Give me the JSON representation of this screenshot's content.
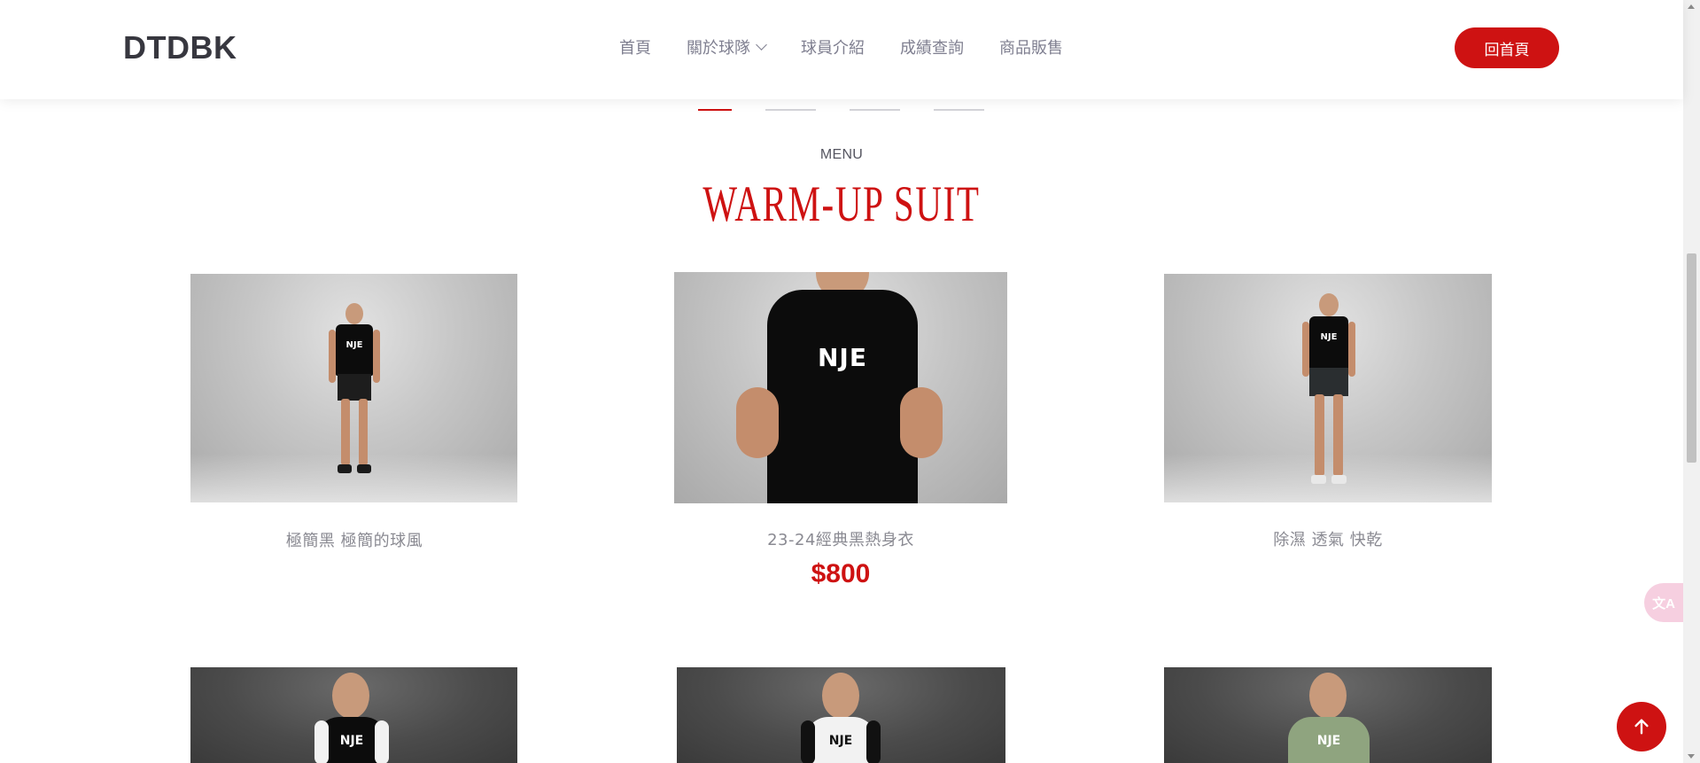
{
  "header": {
    "logo": "DTDBK",
    "nav": [
      {
        "label": "首頁"
      },
      {
        "label": "關於球隊",
        "has_dropdown": true
      },
      {
        "label": "球員介紹"
      },
      {
        "label": "成績查詢"
      },
      {
        "label": "商品販售"
      }
    ],
    "home_button": "回首頁"
  },
  "section": {
    "subtitle": "MENU",
    "title": "WARM-UP SUIT"
  },
  "products": [
    {
      "name": "極簡黑 極簡的球風",
      "price": ""
    },
    {
      "name": "23-24經典黑熱身衣",
      "price": "$800"
    },
    {
      "name": "除濕 透氣 快乾",
      "price": ""
    }
  ],
  "shirt_logo_text": "NJE",
  "floating": {
    "translate_label": "文A",
    "back_to_top_icon": "arrow-up-icon"
  },
  "colors": {
    "accent": "#ce1212",
    "text_muted": "#8a8a92",
    "logo": "#37373f"
  }
}
